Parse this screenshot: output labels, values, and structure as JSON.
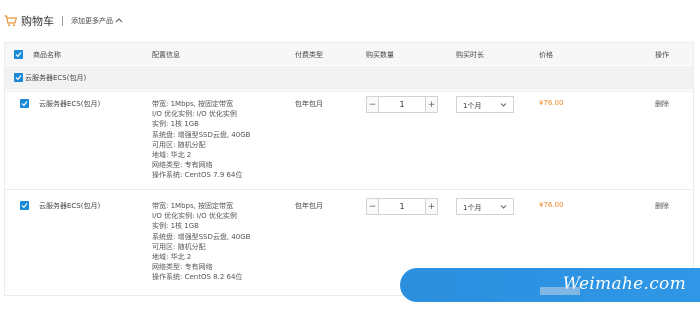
{
  "header": {
    "title": "购物车",
    "add_more": "添加更多产品",
    "accent": "#e8953a"
  },
  "columns": {
    "name": "商品名称",
    "config": "配置信息",
    "pay_type": "付费类型",
    "quantity": "购买数量",
    "duration": "购买时长",
    "price": "价格",
    "actions": "操作"
  },
  "group": {
    "label": "云服务器ECS(包月)"
  },
  "rows": [
    {
      "name": "云服务器ECS(包月)",
      "config": [
        "带宽: 1Mbps, 按固定带宽",
        "I/O 优化实例: I/O 优化实例",
        "实例: 1核 1GB",
        "系统盘: 增强型SSD云盘, 40GB",
        "可用区: 随机分配",
        "地域: 华北 2",
        "网络类型: 专有网络",
        "操作系统: CentOS 7.9 64位"
      ],
      "pay_type": "包年包月",
      "quantity": "1",
      "duration": "1个月",
      "price": "¥76.00",
      "action": "删除"
    },
    {
      "name": "云服务器ECS(包月)",
      "config": [
        "带宽: 1Mbps, 按固定带宽",
        "I/O 优化实例: I/O 优化实例",
        "实例: 1核 1GB",
        "系统盘: 增强型SSD云盘, 40GB",
        "可用区: 随机分配",
        "地域: 华北 2",
        "网络类型: 专有网络",
        "操作系统: CentOS 8.2 64位"
      ],
      "pay_type": "包年包月",
      "quantity": "1",
      "duration": "1个月",
      "price": "¥76.00",
      "action": "删除"
    }
  ],
  "watermark": {
    "text": "Weimahe.com",
    "color": "#2b8fde"
  },
  "colors": {
    "checkbox": "#1a8ad8",
    "price": "#f08a24"
  }
}
